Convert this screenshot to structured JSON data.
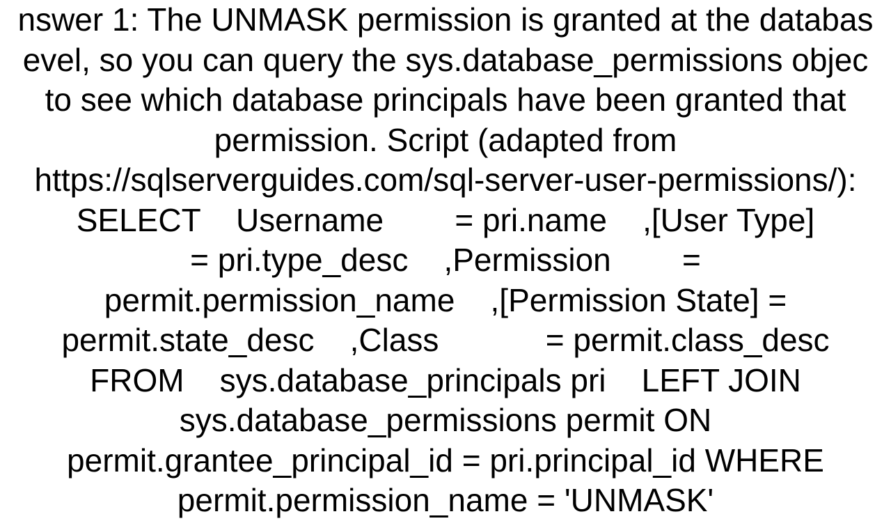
{
  "content": {
    "lines": [
      "nswer 1: The UNMASK permission is granted at the databas",
      "evel, so you can query the sys.database_permissions objec",
      "to see which database principals have been granted that",
      "permission. Script (adapted from",
      "https://sqlserverguides.com/sql-server-user-permissions/):",
      "SELECT    Username        = pri.name    ,[User Type]",
      "= pri.type_desc    ,Permission        =",
      "permit.permission_name    ,[Permission State] =",
      "permit.state_desc    ,Class            = permit.class_desc",
      "FROM    sys.database_principals pri    LEFT JOIN",
      "sys.database_permissions permit ON",
      "permit.grantee_principal_id = pri.principal_id WHERE",
      "permit.permission_name = 'UNMASK'"
    ]
  }
}
